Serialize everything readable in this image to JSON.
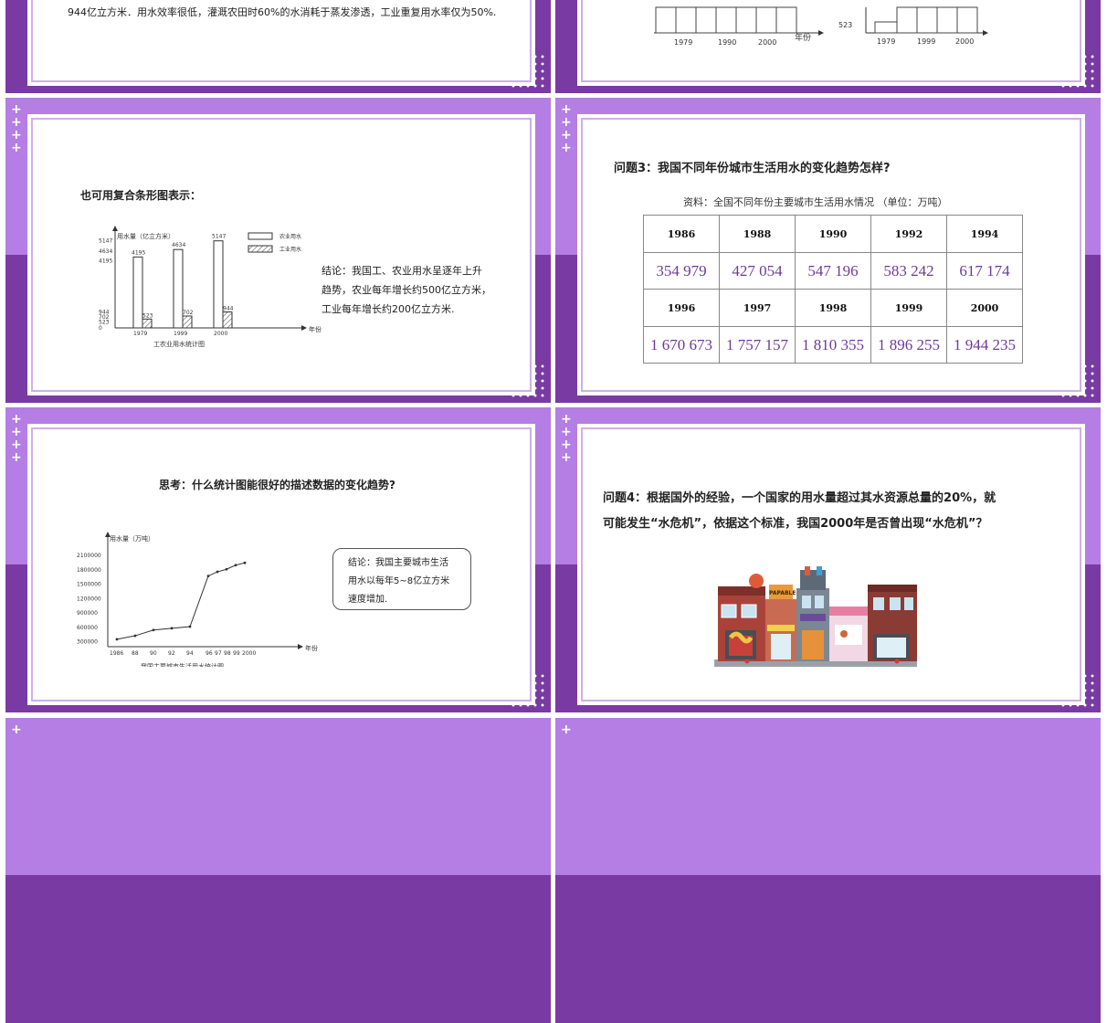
{
  "s1": {
    "text": "944亿立方米．用水效率很低，灌溉农田时60%的水消耗于蒸发渗透，工业重复用水率仅为50%."
  },
  "s2": {
    "left_ticks": [
      "1979",
      "1990",
      "2000"
    ],
    "left_xlabel": "年份",
    "right_ticks": [
      "1979",
      "1999",
      "2000"
    ],
    "right_ylabel": "523"
  },
  "s3": {
    "heading": "也可用复合条形图表示：",
    "chart_data": {
      "type": "bar",
      "title": "工农业用水统计图",
      "ylabel": "用水量（亿立方米）",
      "xlabel": "年份",
      "categories": [
        "1979",
        "1999",
        "2000"
      ],
      "series": [
        {
          "name": "农业用水",
          "values": [
            4195,
            4634,
            5147
          ]
        },
        {
          "name": "工业用水",
          "values": [
            523,
            702,
            944
          ]
        }
      ],
      "ytick_labels": [
        "5147",
        "4634",
        "4195",
        "944",
        "702",
        "523",
        "0"
      ],
      "legend": "top-right"
    },
    "conclusion": [
      "结论：我国工、农业用水呈逐年上升",
      "趋势，农业每年增长约500亿立方米，",
      "工业每年增长约200亿立方米."
    ]
  },
  "s4": {
    "question": "问题3：我国不同年份城市生活用水的变化趋势怎样?",
    "caption": "资料：全国不同年份主要城市生活用水情况 （单位：万吨）",
    "years_a": [
      "1986",
      "1988",
      "1990",
      "1992",
      "1994"
    ],
    "values_a": [
      "354 979",
      "427 054",
      "547 196",
      "583 242",
      "617 174"
    ],
    "years_b": [
      "1996",
      "1997",
      "1998",
      "1999",
      "2000"
    ],
    "values_b": [
      "1 670 673",
      "1 757 157",
      "1 810 355",
      "1 896 255",
      "1 944 235"
    ]
  },
  "s5": {
    "question": "思考：什么统计图能很好的描述数据的变化趋势?",
    "chart_data": {
      "type": "line",
      "title": "我国主要城市生活用水统计图",
      "ylabel": "用水量（万吨）",
      "xlabel": "年份",
      "x": [
        "1986",
        "88",
        "90",
        "92",
        "94",
        "96",
        "97",
        "98",
        "99",
        "2000"
      ],
      "values": [
        354979,
        427054,
        547196,
        583242,
        617174,
        1670673,
        1757157,
        1810355,
        1896255,
        1944235
      ],
      "ytick_labels": [
        "2100000",
        "1800000",
        "1500000",
        "1200000",
        "900000",
        "600000",
        "300000"
      ],
      "ylim": [
        200000,
        2100000
      ]
    },
    "conclusion": [
      "结论：我国主要城市生活",
      "用水以每年5~8亿立方米",
      "速度增加."
    ]
  },
  "s6": {
    "question_line1": "问题4：根据国外的经验，一个国家的用水量超过其水资源总量的20%，就",
    "question_line2": "可能发生“水危机”，依据这个标准，我国2000年是否曾出现“水危机”？",
    "shop_sign": "PAPABLE"
  },
  "colors": {
    "purple_light": "#b47ee4",
    "purple_dark": "#7a3aa3",
    "accent_text": "#6d3a9a"
  }
}
